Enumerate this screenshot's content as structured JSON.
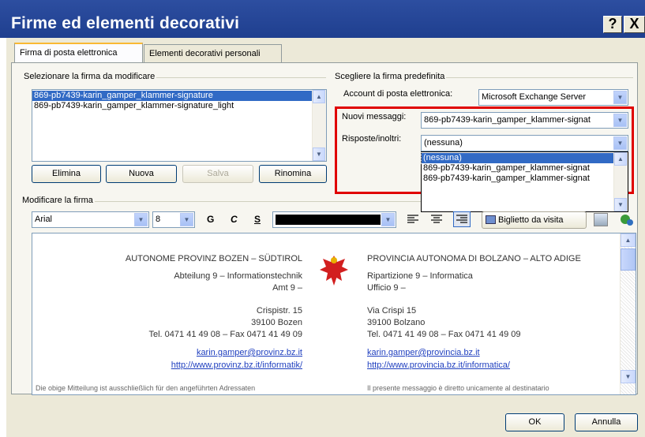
{
  "window": {
    "title": "Firme ed elementi decorativi",
    "help_btn": "?",
    "close_btn": "X"
  },
  "tabs": [
    {
      "label": "Firma di posta elettronica",
      "active": true
    },
    {
      "label": "Elementi decorativi personali",
      "active": false
    }
  ],
  "select_signature": {
    "group_label": "Selezionare la firma da modificare",
    "items": [
      {
        "label": "869-pb7439-karin_gamper_klammer-signature",
        "selected": true
      },
      {
        "label": "869-pb7439-karin_gamper_klammer-signature_light",
        "selected": false
      }
    ]
  },
  "buttons": {
    "delete": "Elimina",
    "new": "Nuova",
    "save": "Salva",
    "rename": "Rinomina",
    "ok": "OK",
    "cancel": "Annulla"
  },
  "default_signature": {
    "group_label": "Scegliere la firma predefinita",
    "account_label": "Account di posta elettronica:",
    "account_value": "Microsoft Exchange Server",
    "new_messages_label": "Nuovi messaggi:",
    "new_messages_value": "869-pb7439-karin_gamper_klammer-signat",
    "replies_label": "Risposte/inoltri:",
    "replies_value": "(nessuna)",
    "dropdown_options": [
      {
        "label": "(nessuna)",
        "selected": true
      },
      {
        "label": "869-pb7439-karin_gamper_klammer-signat",
        "selected": false
      },
      {
        "label": "869-pb7439-karin_gamper_klammer-signat",
        "selected": false
      }
    ]
  },
  "edit_signature": {
    "group_label": "Modificare la firma",
    "font": "Arial",
    "size": "8",
    "bold": "G",
    "italic": "C",
    "underline": "S",
    "business_card": "Biglietto da visita"
  },
  "signature_left": {
    "org": "AUTONOME PROVINZ BOZEN – SÜDTIROL",
    "dept": "Abteilung 9 – Informationstechnik",
    "office": "Amt 9 –",
    "street": "Crispistr. 15",
    "city": "39100 Bozen",
    "phone": "Tel. 0471 41 49 08 – Fax 0471 41 49 09",
    "email": "karin.gamper@provinz.bz.it",
    "url": "http://www.provinz.bz.it/informatik/",
    "disclaimer": "Die obige Mitteilung ist ausschließlich für den angeführten Adressaten"
  },
  "signature_right": {
    "org": "PROVINCIA AUTONOMA DI BOLZANO – ALTO ADIGE",
    "dept": "Ripartizione 9 – Informatica",
    "office": "Ufficio 9 –",
    "street": "Via Crispi 15",
    "city": "39100 Bolzano",
    "phone": "Tel. 0471 41 49 08 – Fax 0471 41 49 09",
    "email": "karin.gamper@provincia.bz.it",
    "url": "http://www.provincia.bz.it/informatica/",
    "disclaimer": "Il presente messaggio è diretto unicamente al destinatario"
  },
  "colors": {
    "titlebar": "#1f3f8f",
    "highlight": "#316ac5",
    "red_frame": "#e00000",
    "eagle": "#d21f1f"
  }
}
